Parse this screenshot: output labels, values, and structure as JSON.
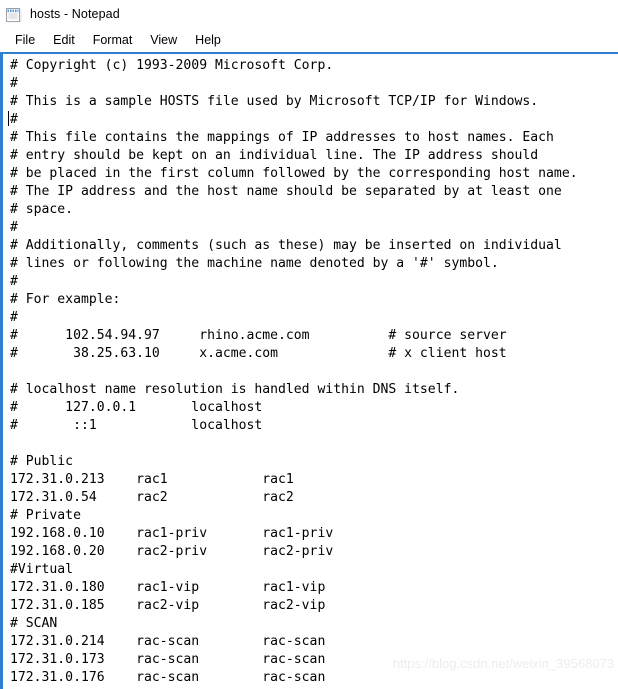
{
  "window": {
    "title": "hosts - Notepad",
    "icon": "notepad-icon",
    "border_color": "#2f7fd0",
    "background_color": "#ffffff"
  },
  "menu": {
    "items": [
      {
        "label": "File"
      },
      {
        "label": "Edit"
      },
      {
        "label": "Format"
      },
      {
        "label": "View"
      },
      {
        "label": "Help"
      }
    ]
  },
  "editor": {
    "font": "monospace",
    "text_color": "#000000",
    "caret_visible": true,
    "lines": [
      "# Copyright (c) 1993-2009 Microsoft Corp.",
      "#",
      "# This is a sample HOSTS file used by Microsoft TCP/IP for Windows.",
      "#",
      "# This file contains the mappings of IP addresses to host names. Each",
      "# entry should be kept on an individual line. The IP address should",
      "# be placed in the first column followed by the corresponding host name.",
      "# The IP address and the host name should be separated by at least one",
      "# space.",
      "#",
      "# Additionally, comments (such as these) may be inserted on individual",
      "# lines or following the machine name denoted by a '#' symbol.",
      "#",
      "# For example:",
      "#",
      "#      102.54.94.97     rhino.acme.com          # source server",
      "#       38.25.63.10     x.acme.com              # x client host",
      "",
      "# localhost name resolution is handled within DNS itself.",
      "#      127.0.0.1       localhost",
      "#       ::1            localhost",
      "",
      "# Public",
      "172.31.0.213    rac1            rac1",
      "172.31.0.54     rac2            rac2",
      "# Private",
      "192.168.0.10    rac1-priv       rac1-priv",
      "192.168.0.20    rac2-priv       rac2-priv",
      "#Virtual",
      "172.31.0.180    rac1-vip        rac1-vip",
      "172.31.0.185    rac2-vip        rac2-vip",
      "# SCAN",
      "172.31.0.214    rac-scan        rac-scan",
      "172.31.0.173    rac-scan        rac-scan",
      "172.31.0.176    rac-scan        rac-scan"
    ]
  },
  "watermark": {
    "text": "https://blog.csdn.net/weixin_39568073",
    "color": "#ededed"
  }
}
